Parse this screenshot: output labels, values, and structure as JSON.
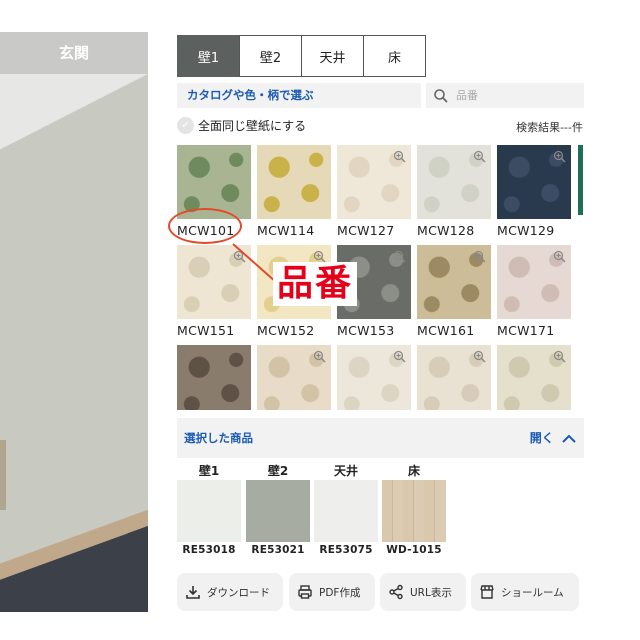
{
  "room": {
    "title": "玄関"
  },
  "tabs": [
    {
      "label": "壁1",
      "active": true
    },
    {
      "label": "壁2",
      "active": false
    },
    {
      "label": "天井",
      "active": false
    },
    {
      "label": "床",
      "active": false
    }
  ],
  "catalog": {
    "label": "カタログや色・柄で選ぶ"
  },
  "search": {
    "placeholder": "品番"
  },
  "same_wallpaper": {
    "label": "全面同じ壁紙にする"
  },
  "result_count": "検索結果---件",
  "products": [
    {
      "code": "MCW101",
      "color": "#a9b592",
      "accent": "#6f8a5c"
    },
    {
      "code": "MCW114",
      "color": "#e6d9b8",
      "accent": "#c9b24a"
    },
    {
      "code": "MCW127",
      "color": "#efe7d8",
      "accent": "#e2d6c2"
    },
    {
      "code": "MCW128",
      "color": "#e2e2da",
      "accent": "#d0d2c6"
    },
    {
      "code": "MCW129",
      "color": "#2a3a4e",
      "accent": "#3b4c63"
    },
    {
      "code": "MCW151",
      "color": "#eee6d3",
      "accent": "#d8cfb6"
    },
    {
      "code": "MCW152",
      "color": "#f2e7c2",
      "accent": "#e3cf8e"
    },
    {
      "code": "MCW153",
      "color": "#6a6c68",
      "accent": "#8c8e88"
    },
    {
      "code": "MCW161",
      "color": "#cdbc98",
      "accent": "#9c8a62"
    },
    {
      "code": "MCW171",
      "color": "#e6d8d2",
      "accent": "#cfbcb4"
    },
    {
      "code": "",
      "color": "#8a7c6c",
      "accent": "#5e5246"
    },
    {
      "code": "",
      "color": "#e8dcc8",
      "accent": "#d2c3a6"
    },
    {
      "code": "",
      "color": "#ece7da",
      "accent": "#dcd5c4"
    },
    {
      "code": "",
      "color": "#e9e1d1",
      "accent": "#d7ccb8"
    },
    {
      "code": "",
      "color": "#e4e0cc",
      "accent": "#cfc9b0"
    }
  ],
  "annotation": {
    "label": "品番"
  },
  "selected": {
    "title": "選択した商品",
    "toggle": "開く",
    "items": [
      {
        "label": "壁1",
        "code": "RE53018",
        "color": "#eceeea"
      },
      {
        "label": "壁2",
        "code": "RE53021",
        "color": "#a6aca2"
      },
      {
        "label": "天井",
        "code": "RE53075",
        "color": "#eeeeec"
      },
      {
        "label": "床",
        "code": "WD-1015",
        "color": "#d8c6ae"
      }
    ]
  },
  "actions": [
    {
      "label": "ダウンロード",
      "icon": "download-icon"
    },
    {
      "label": "PDF作成",
      "icon": "printer-icon"
    },
    {
      "label": "URL表示",
      "icon": "share-icon"
    },
    {
      "label": "ショールーム",
      "icon": "store-icon"
    }
  ],
  "colors": {
    "accent_blue": "#1b5bb5",
    "tab_active": "#5c615f",
    "annotation_red": "#e6001a",
    "scrollbar": "#1f6e5a"
  }
}
